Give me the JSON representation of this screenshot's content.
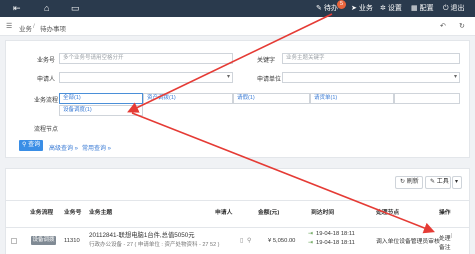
{
  "topbar": {
    "items": [
      {
        "icon": "bell-icon",
        "label": "待办",
        "badge": "5"
      },
      {
        "icon": "send-icon",
        "label": "业务"
      },
      {
        "icon": "gear-icon",
        "label": "设置"
      },
      {
        "icon": "grid-icon",
        "label": "配置"
      },
      {
        "icon": "power-icon",
        "label": "退出"
      }
    ]
  },
  "breadcrumb": {
    "home": "业务",
    "sep": "/",
    "current": "待办事项"
  },
  "filters": {
    "business_no_label": "业务号",
    "business_no_placeholder": "多个业务号请用空格分开",
    "keyword_label": "关键字",
    "keyword_placeholder": "业务主题关键字",
    "applicant_label": "申请人",
    "applicant_value": "",
    "dept_label": "申请单位",
    "dept_value": "",
    "flow_label": "业务流程",
    "flow_options": [
      "全部(1)",
      "资产调拨(1)",
      "请假(1)",
      "请货单(1)",
      "设备调度(1)"
    ],
    "node_label": "流程节点",
    "search_button": "查询",
    "advanced_link": "高级查询 »",
    "common_link": "常用查询 »"
  },
  "toolbar": {
    "refresh": "刷新",
    "tools": "工具"
  },
  "table": {
    "headers": [
      "业务流程",
      "业务号",
      "业务主题",
      "申请人",
      "金额(元)",
      "到达时间",
      "处理节点",
      "操作"
    ],
    "rows": [
      {
        "flow": "设备调拨",
        "no": "11310",
        "title": "20112841-联想电脑1台件,总值5050元",
        "desc": "行政办公设备 - 27 ( 申请单位 : 资产处物资科 - 27 52 )",
        "amount": "¥ 5,050.00",
        "time1": "19-04-18 18:11",
        "time2": "19-04-18 18:11",
        "node": "调入单位设备管理员审核",
        "op_handle": "处理",
        "op_sep": "|",
        "op_note": "备注"
      }
    ]
  },
  "colors": {
    "topbar": "#2a3a4d",
    "accent": "#3a8ee6",
    "arrow": "#e53b35"
  }
}
